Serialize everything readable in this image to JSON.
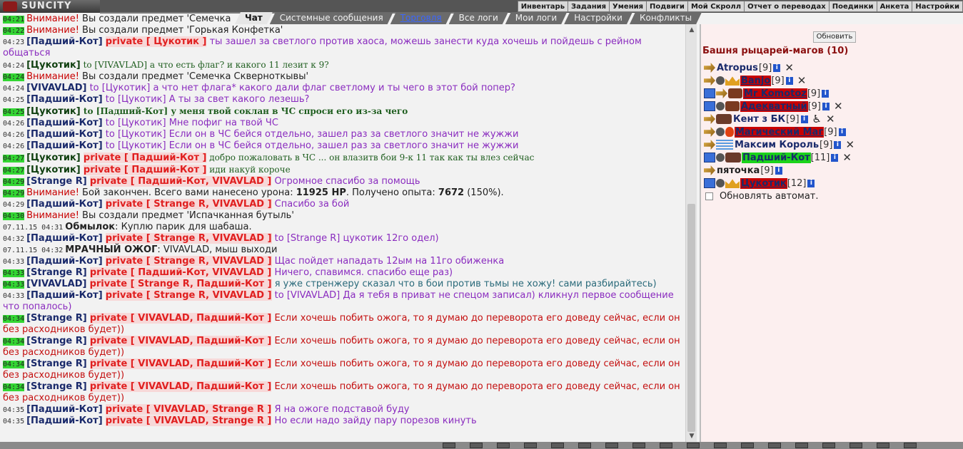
{
  "app": {
    "logo_text": "SUNCITY"
  },
  "top_nav": [
    "Инвентарь",
    "Задания",
    "Умения",
    "Подвиги",
    "Мой Скролл",
    "Отчет о переводах",
    "Поединки",
    "Анкета",
    "Настройки"
  ],
  "tabs": [
    {
      "label": "Чат",
      "active": true
    },
    {
      "label": "Системные сообщения",
      "active": false
    },
    {
      "label": "Торговля",
      "active": false
    },
    {
      "label": "Все логи",
      "active": false
    },
    {
      "label": "Мои логи",
      "active": false
    },
    {
      "label": "Настройки",
      "active": false
    },
    {
      "label": "Конфликты",
      "active": false
    }
  ],
  "chat": [
    {
      "time": "04:21",
      "hl": true,
      "kind": "sys",
      "warn": "Внимание!",
      "text": " Вы создали предмет 'Семечка"
    },
    {
      "time": "04:22",
      "hl": true,
      "kind": "sys",
      "warn": "Внимание!",
      "text": " Вы создали предмет 'Горькая Конфетка'"
    },
    {
      "time": "04:23",
      "hl": false,
      "kind": "msg",
      "nick": "[Падший-Кот]",
      "priv": "private [ Цукотик ]",
      "text": " ты зашел за светлого против хаоса, можешь занести куда хочешь и пойдешь с рейном общаться",
      "color": "purple"
    },
    {
      "time": "04:24",
      "hl": false,
      "kind": "msg",
      "nick": "[Цукотик]",
      "nick_green": true,
      "priv": "",
      "text": " to [VIVAVLAD] а что есть флаг? и какого 11 лезит к 9?",
      "color": "darkgreen"
    },
    {
      "time": "04:24",
      "hl": true,
      "kind": "sys",
      "warn": "Внимание!",
      "text": " Вы создали предмет 'Семечка Скверноткывы'"
    },
    {
      "time": "04:24",
      "hl": false,
      "kind": "msg",
      "nick": "[VIVAVLAD]",
      "priv": "",
      "text": " to [Цукотик] а что нет флага* какого дали флаг светлому и ты чего в этот бой попер?",
      "color": "purple"
    },
    {
      "time": "04:25",
      "hl": false,
      "kind": "msg",
      "nick": "[Падший-Кот]",
      "priv": "",
      "text": " to [Цукотик] А ты за свет какого лезешь?",
      "color": "purple"
    },
    {
      "time": "04:25",
      "hl": true,
      "kind": "msg",
      "nick": "[Цукотик]",
      "nick_green": true,
      "priv": "",
      "text": " to [Падший-Кот] у меня твой соклан в ЧС спроси его из-за чего",
      "color": "darkgreen",
      "bold_to": true
    },
    {
      "time": "04:26",
      "hl": false,
      "kind": "msg",
      "nick": "[Падший-Кот]",
      "priv": "",
      "text": " to [Цукотик] Мне пофиг на твой ЧС",
      "color": "purple"
    },
    {
      "time": "04:26",
      "hl": false,
      "kind": "msg",
      "nick": "[Падший-Кот]",
      "priv": "",
      "text": " to [Цукотик] Если он в ЧС бейся отдельно, зашел раз за светлого значит не жужжи",
      "color": "purple"
    },
    {
      "time": "04:26",
      "hl": false,
      "kind": "msg",
      "nick": "[Падший-Кот]",
      "priv": "",
      "text": " to [Цукотик] Если он в ЧС бейся отдельно, зашел раз за светлого значит не жужжи",
      "color": "purple"
    },
    {
      "time": "04:27",
      "hl": true,
      "kind": "msg",
      "nick": "[Цукотик]",
      "nick_green": true,
      "priv": "private [ Падший-Кот ]",
      "text": " добро пожаловать в ЧС ... он влазитв бои 9-к 11 так как ты влез сейчас",
      "color": "darkgreen"
    },
    {
      "time": "04:27",
      "hl": true,
      "kind": "msg",
      "nick": "[Цукотик]",
      "nick_green": true,
      "priv": "private [ Падший-Кот ]",
      "text": " иди накуй короче",
      "color": "darkgreen"
    },
    {
      "time": "04:29",
      "hl": true,
      "kind": "msg",
      "nick": "[Strange R]",
      "priv": "private [ Падший-Кот, VIVAVLAD ]",
      "text": " Огромное спасибо за помощь",
      "color": "purple"
    },
    {
      "time": "04:29",
      "hl": true,
      "kind": "battle",
      "warn": "Внимание!",
      "text1": " Бой закончен. Всего вами нанесено урона: ",
      "dmg": "11925 HP",
      "text2": ". Получено опыта: ",
      "exp": "7672",
      "text3": " (150%)."
    },
    {
      "time": "04:29",
      "hl": false,
      "kind": "msg",
      "nick": "[Падший-Кот]",
      "priv": "private [ Strange R, VIVAVLAD ]",
      "text": " Спасибо за бой",
      "color": "purple"
    },
    {
      "time": "04:30",
      "hl": true,
      "kind": "sys",
      "warn": "Внимание!",
      "text": " Вы создали предмет 'Испачканная бутыль'"
    },
    {
      "time": "07.11.15 04:31",
      "hl": false,
      "kind": "plain",
      "nick": "Обмылок",
      "text": ": Куплю парик для шабаша."
    },
    {
      "time": "04:32",
      "hl": false,
      "kind": "msg",
      "nick": "[Падший-Кот]",
      "priv": "private [ Strange R, VIVAVLAD ]",
      "text": " to [Strange R] цукотик 12го одел)",
      "color": "purple"
    },
    {
      "time": "07.11.15 04:32",
      "hl": false,
      "kind": "plain",
      "nick": "МРАЧНЫЙ ОЖОГ",
      "text": ": VIVAVLAD, мыш выходи"
    },
    {
      "time": "04:33",
      "hl": false,
      "kind": "msg",
      "nick": "[Падший-Кот]",
      "priv": "private [ Strange R, VIVAVLAD ]",
      "text": " Щас пойдет нападать 12ым на 11го обиженка",
      "color": "purple"
    },
    {
      "time": "04:33",
      "hl": true,
      "kind": "msg",
      "nick": "[Strange R]",
      "priv": "private [ Падший-Кот, VIVAVLAD ]",
      "text": " Ничего, спавимся. спасибо еще раз)",
      "color": "purple"
    },
    {
      "time": "04:33",
      "hl": true,
      "kind": "msg",
      "nick": "[VIVAVLAD]",
      "priv": "private [ Strange R, Падший-Кот ]",
      "text": " я уже стренжеру сказал что в бои против тьмы не хожу! сами разбирайтесь)",
      "color": "teal"
    },
    {
      "time": "04:33",
      "hl": false,
      "kind": "msg",
      "nick": "[Падший-Кот]",
      "priv": "private [ Strange R, VIVAVLAD ]",
      "text": " to [VIVAVLAD] Да я тебя в приват не спецом записал) кликнул первое сообщение что попалось)",
      "color": "purple"
    },
    {
      "time": "04:34",
      "hl": true,
      "kind": "msg",
      "nick": "[Strange R]",
      "priv": "private [ VIVAVLAD, Падший-Кот ]",
      "text": " Если хочешь побить ожога, то я думаю до переворота его доведу сейчас, если он без расходников будет))",
      "color": "red"
    },
    {
      "time": "04:34",
      "hl": true,
      "kind": "msg",
      "nick": "[Strange R]",
      "priv": "private [ VIVAVLAD, Падший-Кот ]",
      "text": " Если хочешь побить ожога, то я думаю до переворота его доведу сейчас, если он без расходников будет))",
      "color": "red"
    },
    {
      "time": "04:34",
      "hl": true,
      "kind": "msg",
      "nick": "[Strange R]",
      "priv": "private [ VIVAVLAD, Падший-Кот ]",
      "text": " Если хочешь побить ожога, то я думаю до переворота его доведу сейчас, если он без расходников будет))",
      "color": "red"
    },
    {
      "time": "04:34",
      "hl": true,
      "kind": "msg",
      "nick": "[Strange R]",
      "priv": "private [ VIVAVLAD, Падший-Кот ]",
      "text": " Если хочешь побить ожога, то я думаю до переворота его доведу сейчас, если он без расходников будет))",
      "color": "red"
    },
    {
      "time": "04:35",
      "hl": false,
      "kind": "msg",
      "nick": "[Падший-Кот]",
      "priv": "private [ VIVAVLAD, Strange R ]",
      "text": " Я на ожоге подставой буду",
      "color": "purple"
    },
    {
      "time": "04:35",
      "hl": false,
      "kind": "msg",
      "nick": "[Падший-Кот]",
      "priv": "private [ VIVAVLAD, Strange R ]",
      "text": " Но если надо зайду пару порезов кинуть",
      "color": "purple"
    }
  ],
  "panel": {
    "refresh_label": "Обновить",
    "room_title": "Башня рыцарей-магов (10)",
    "auto_refresh_label": "Обновлять автомат.",
    "users": [
      {
        "name": "Atropus",
        "level": "[9]",
        "style": "plain",
        "icons": [
          "arrow"
        ],
        "x": true,
        "extra": ""
      },
      {
        "name": "Banjo",
        "level": "[9]",
        "style": "red",
        "icons": [
          "arrow",
          "gear",
          "crown"
        ],
        "x": true,
        "extra": ""
      },
      {
        "name": "Mr Komotoz",
        "level": "[9]",
        "style": "red",
        "icons": [
          "screen",
          "arrow",
          "badge"
        ],
        "x": false,
        "extra": ""
      },
      {
        "name": "Адекватный",
        "level": "[9]",
        "style": "red",
        "icons": [
          "screen",
          "gear",
          "badge"
        ],
        "x": true,
        "extra": ""
      },
      {
        "name": "Кент з БК",
        "level": "[9]",
        "style": "plain",
        "icons": [
          "arrow",
          "avatar"
        ],
        "x": true,
        "extra": "♿"
      },
      {
        "name": "Магический Маг",
        "level": "[9]",
        "style": "red",
        "icons": [
          "arrow",
          "gear",
          "fire"
        ],
        "x": false,
        "extra": ""
      },
      {
        "name": "Максим Король",
        "level": "[9]",
        "style": "plain",
        "icons": [
          "arrow",
          "wave"
        ],
        "x": true,
        "extra": ""
      },
      {
        "name": "Падший-Кот",
        "level": "[11]",
        "style": "green",
        "icons": [
          "screen",
          "gear",
          "avatar"
        ],
        "x": true,
        "extra": ""
      },
      {
        "name": "пяточка",
        "level": "[9]",
        "style": "plain_black",
        "icons": [
          "arrow"
        ],
        "x": false,
        "extra": ""
      },
      {
        "name": "Цукотик",
        "level": "[12]",
        "style": "red",
        "icons": [
          "screen",
          "gear",
          "crown"
        ],
        "x": false,
        "extra": ""
      }
    ]
  },
  "colors": {
    "accent_green": "#33d633",
    "private_red": "#e02020",
    "nick_blue": "#1a2a6b",
    "room_title": "#8b1010"
  }
}
